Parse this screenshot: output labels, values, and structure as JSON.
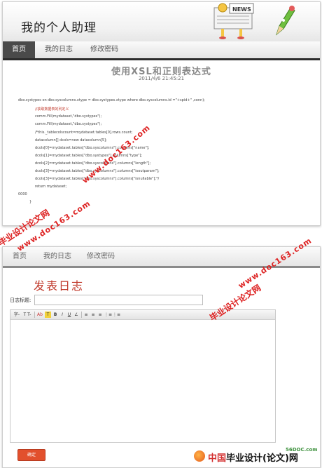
{
  "top_screen": {
    "app_title": "我的个人助理",
    "nav": [
      "首页",
      "我的日志",
      "修改密码"
    ],
    "article": {
      "title": "使用XSL和正则表达式",
      "date": "2011/4/6 21:45:21",
      "code_lines": [
        "dbo.systypes on dbo.syscolumns.xtype = dbo.systypes.xtype where dbo.syscolumns.id =\"+spid+\" ,conn);",
        "//获取数据表的列定义",
        "comm.Fill(mydataset,\"dbo.systypes\");",
        "comm.Fill(mydataset,\"dbo.systypes\");",
        "/*this._tablecolscount=mydataset.tables[0].rows.count;",
        "datacolumn[] dcols=new datacolumn[5];",
        "dcols[0]=mydataset.tables[\"dbo.syscolumns\"].columns[\"name\"];",
        "dcols[1]=mydataset.tables[\"dbo.systypes\"].columns[\"type\"];",
        "dcols[2]=mydataset.tables[\"dbo.syscolumns\"].columns[\"length\"];",
        "dcols[3]=mydataset.tables[\"dbo.syscolumns\"].columns[\"isoutparam\"];",
        "dcols[3]=mydataset.tables[\"dbo.syscolumns\"].columns[\"isnullable\"];*/",
        "return mydataset;",
        "0000",
        "}"
      ]
    }
  },
  "bottom_screen": {
    "nav": [
      "首页",
      "我的日志",
      "修改密码"
    ],
    "form_title": "发表日志",
    "title_label": "日志标题:",
    "title_value": "",
    "toolbar_buttons": [
      "字-",
      "T T-",
      "Ab",
      "T",
      "B",
      "I",
      "U",
      "∠",
      "≡",
      "≡",
      "≡",
      "⋮≡",
      "⋮≡"
    ],
    "submit_label": "确定"
  },
  "watermarks": {
    "cn": "毕业设计论文网",
    "url": "www.doc163.com"
  },
  "footer_logo": {
    "site": "56DOC.com",
    "china": "中国",
    "text": "毕业设计(论文)网"
  },
  "colors": {
    "accent_red": "#c0392b",
    "nav_active": "#4a4a4a",
    "watermark_red": "#dd2222",
    "button_orange": "#e2502d"
  }
}
